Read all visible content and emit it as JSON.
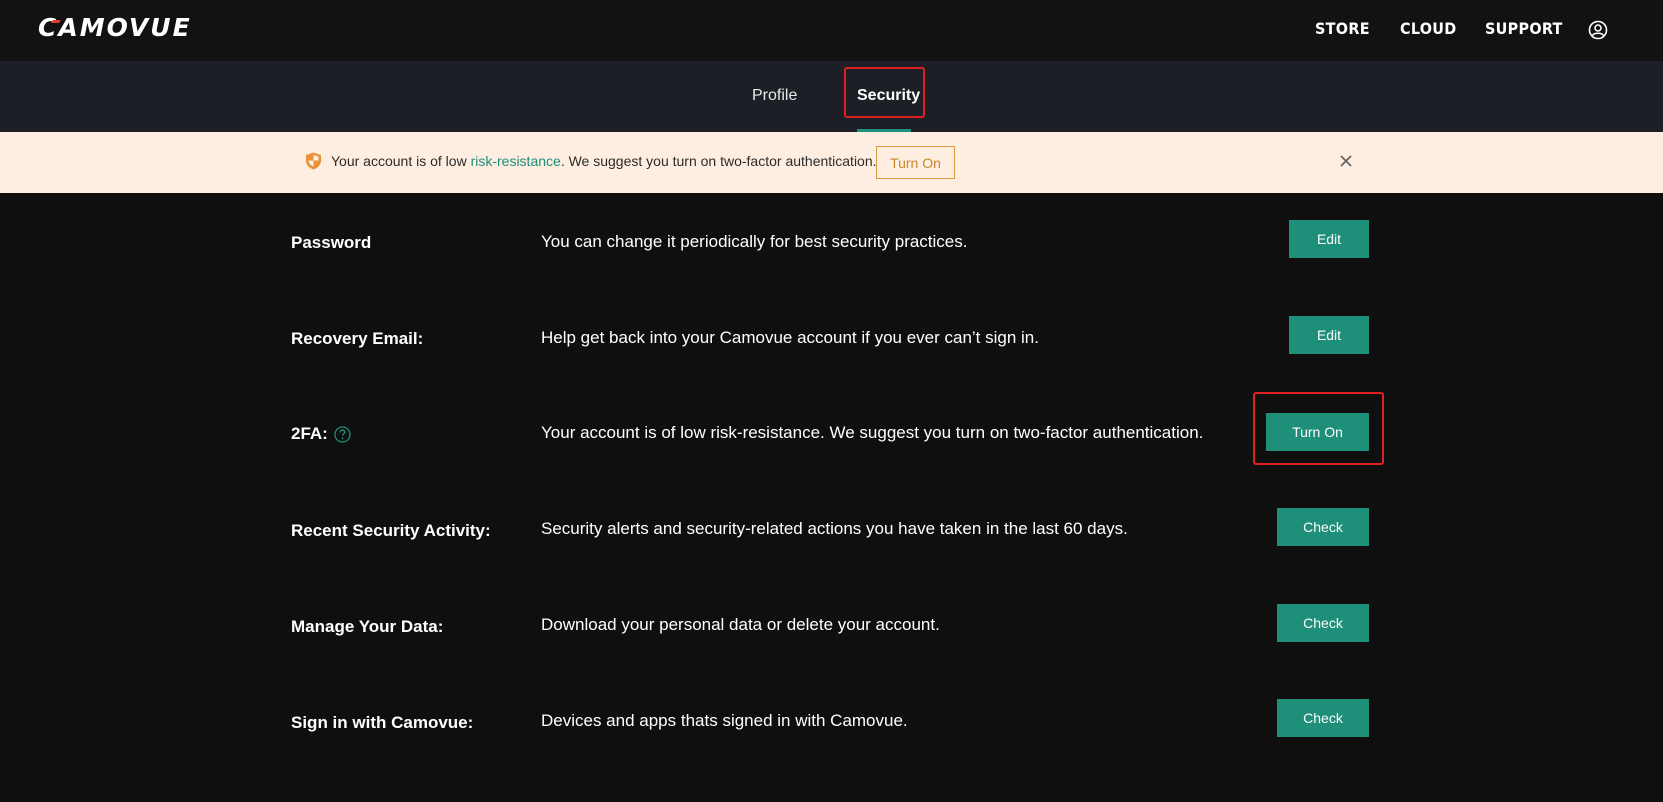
{
  "header": {
    "logo_text": "CAMOVUE",
    "nav": [
      "STORE",
      "CLOUD",
      "SUPPORT"
    ],
    "user_icon": "user-circle-icon"
  },
  "tabs": {
    "items": [
      "Profile",
      "Security"
    ],
    "active": "Security"
  },
  "banner": {
    "icon": "shield-icon",
    "text_before": "Your account is of low ",
    "link": "risk-resistance",
    "text_after": ". We suggest you turn on two-factor authentication.",
    "button_label": "Turn On",
    "close_icon": "close-icon"
  },
  "rows": [
    {
      "title": "Password",
      "description": "You can change it periodically for best security practices.",
      "button": "Edit"
    },
    {
      "title": "Recovery Email:",
      "description": "Help get back into your Camovue account if you ever can’t sign in.",
      "button": "Edit"
    },
    {
      "title": "2FA:",
      "description": "Your account is of low risk-resistance. We suggest you turn on two-factor authentication.",
      "button": "Turn On"
    },
    {
      "title": "Recent Security Activity:",
      "description": "Security alerts and security-related actions you have taken in the last 60 days.",
      "button": "Check"
    },
    {
      "title": "Manage Your Data:",
      "description": "Download your personal data or delete your account.",
      "button": "Check"
    },
    {
      "title": "Sign in with Camovue:",
      "description": "Devices and apps thats signed in with Camovue.",
      "button": "Check"
    }
  ],
  "colors": {
    "accent": "#1e8f78",
    "banner_bg": "#fdeee1",
    "highlight": "#e02020",
    "warning": "#d99a3e"
  }
}
